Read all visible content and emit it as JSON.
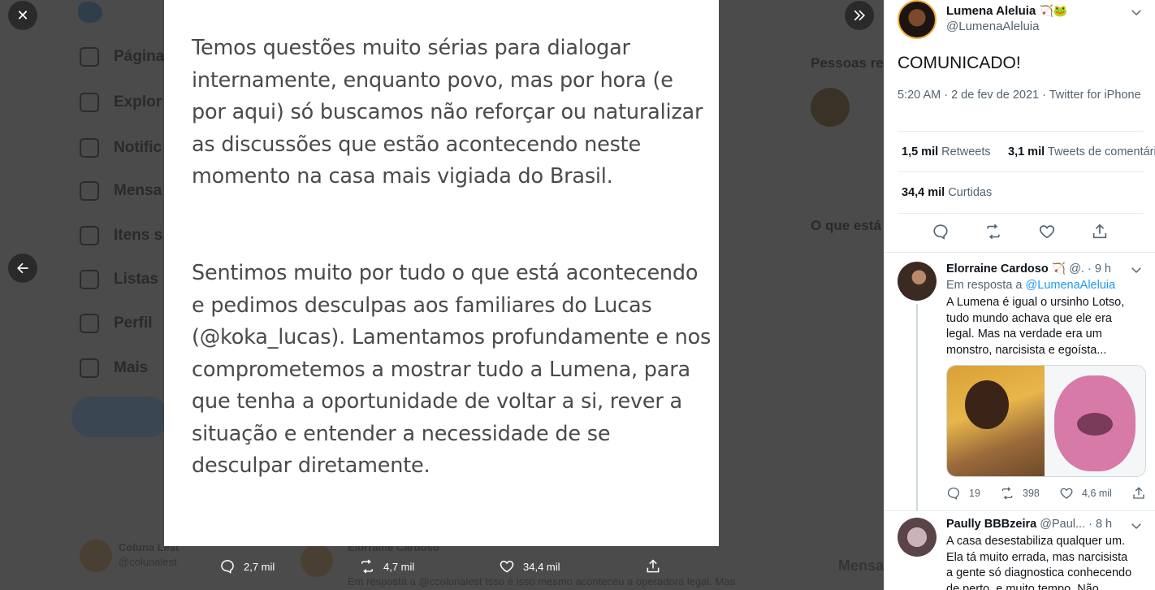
{
  "background": {
    "nav": [
      "Página",
      "Explor",
      "Notific",
      "Mensa",
      "Itens s",
      "Listas",
      "Perfil",
      "Mais"
    ],
    "right_titles": [
      "Pessoas re",
      "O que está"
    ],
    "bottom": {
      "name": "Coluna Lest",
      "handle": "@colunalest",
      "reply_name": "Elorraine Cardoso",
      "reply_text": "Em resposta a @ccolunalest Isso é isso mesmo aconteceu a operadora legal. Mas",
      "right_label": "Mensa"
    }
  },
  "overlay": {
    "close_label": "✕",
    "media_text": {
      "paragraph1": "Temos questões muito sérias para dialogar internamente, enquanto povo, mas por hora (e por aqui) só buscamos não reforçar ou naturalizar as discussões que estão acontecendo neste momento na casa mais vigiada do Brasil.",
      "paragraph2": "Sentimos muito por tudo o que está acontecendo e pedimos desculpas aos familiares do Lucas (@koka_lucas). Lamentamos profundamente e nos comprometemos a mostrar tudo a Lumena, para que tenha a oportunidade de voltar a si, rever a situação e entender a necessidade de se desculpar diretamente."
    },
    "actions": {
      "replies": "2,7 mil",
      "retweets": "4,7 mil",
      "likes": "34,4 mil"
    }
  },
  "tweet": {
    "author_name": "Lumena Aleluia",
    "author_emoji": "🏹🐸",
    "author_handle": "@LumenaAleluia",
    "text": "COMUNICADO!",
    "meta": "5:20 AM · 2 de fev de 2021 · Twitter for iPhone",
    "retweets_count": "1,5 mil",
    "retweets_label": "Retweets",
    "quote_count": "3,1 mil",
    "quote_label": "Tweets de comentário",
    "likes_count": "34,4 mil",
    "likes_label": "Curtidas"
  },
  "replies": [
    {
      "name": "Elorraine Cardoso",
      "emoji": "🏹",
      "handle": "@. · 9 h",
      "reply_to_prefix": "Em resposta a",
      "reply_to": "@LumenaAleluia",
      "text": "A Lumena é igual o ursinho Lotso, tudo mundo achava que ele era legal. Mas na verdade era um monstro, narcisista e egoísta...",
      "replies": "19",
      "retweets": "398",
      "likes": "4,6 mil"
    },
    {
      "name": "Paully BBBzeira",
      "handle": "@Paul... · 8 h",
      "text": "A casa desestabiliza qualquer um. Ela tá muito errada, mas narcisista a gente só diagnostica conhecendo de perto, e muito tempo. Não"
    }
  ],
  "colors": {
    "accent": "#1d9bf0",
    "overlay_bg": "#3d3d3d",
    "text_secondary": "#536471"
  }
}
